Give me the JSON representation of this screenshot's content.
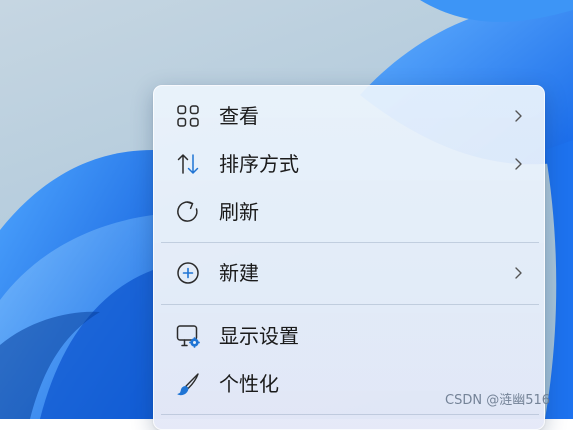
{
  "context_menu": {
    "items": [
      {
        "label": "查看",
        "icon": "view-grid-icon",
        "has_submenu": true
      },
      {
        "label": "排序方式",
        "icon": "sort-arrows-icon",
        "has_submenu": true
      },
      {
        "label": "刷新",
        "icon": "refresh-icon",
        "has_submenu": false
      },
      {
        "label": "新建",
        "icon": "new-plus-icon",
        "has_submenu": true
      },
      {
        "label": "显示设置",
        "icon": "display-settings-icon",
        "has_submenu": false
      },
      {
        "label": "个性化",
        "icon": "brush-icon",
        "has_submenu": false
      }
    ]
  },
  "watermark": {
    "text": "CSDN @涟幽516"
  },
  "colors": {
    "accent_blue": "#1f74d4",
    "icon_dark": "#2b2b2b",
    "text": "#1b1b1b",
    "wallpaper_blue": "#1a7bf0"
  }
}
